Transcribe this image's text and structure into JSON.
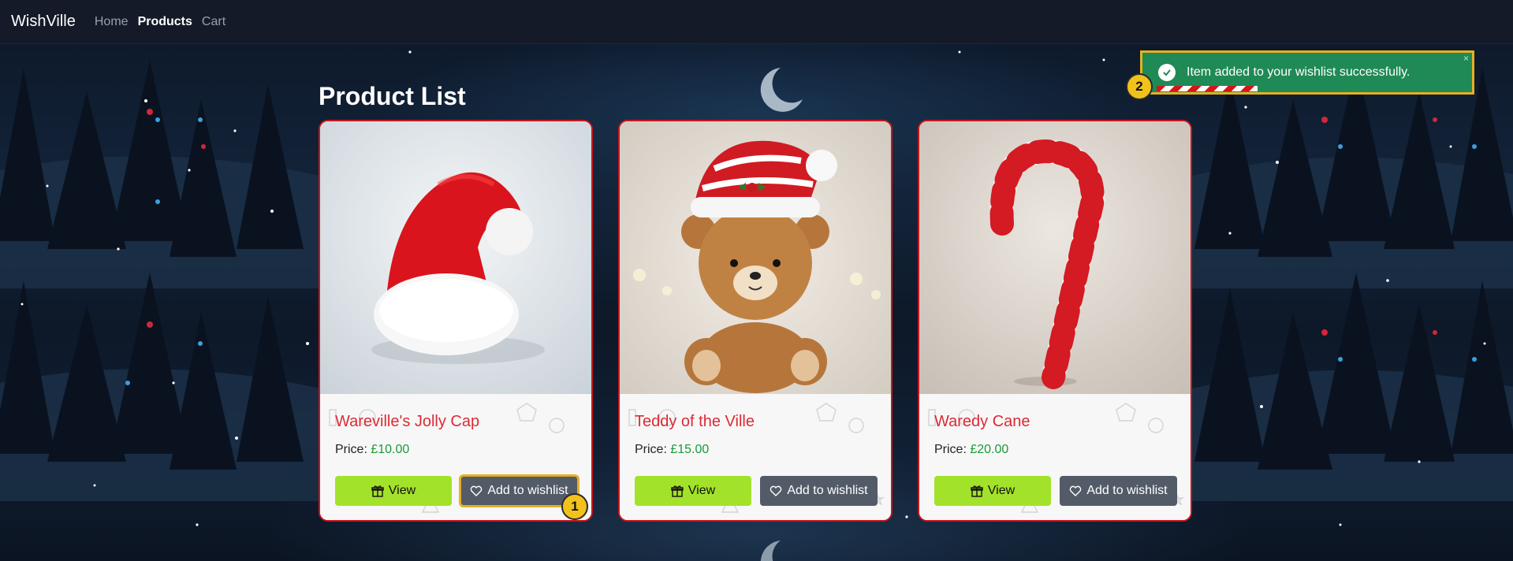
{
  "navbar": {
    "brand": "WishVille",
    "links": [
      {
        "label": "Home",
        "active": false
      },
      {
        "label": "Products",
        "active": true
      },
      {
        "label": "Cart",
        "active": false
      }
    ]
  },
  "page": {
    "title": "Product List"
  },
  "products": [
    {
      "name": "Wareville's Jolly Cap",
      "price_label": "Price:",
      "price": "£10.00",
      "image": "santa-hat",
      "view_label": "View",
      "wishlist_label": "Add to wishlist"
    },
    {
      "name": "Teddy of the Ville",
      "price_label": "Price:",
      "price": "£15.00",
      "image": "teddy-bear",
      "view_label": "View",
      "wishlist_label": "Add to wishlist"
    },
    {
      "name": "Waredy Cane",
      "price_label": "Price:",
      "price": "£20.00",
      "image": "candy-cane",
      "view_label": "View",
      "wishlist_label": "Add to wishlist"
    }
  ],
  "toast": {
    "message": "Item added to your wishlist successfully.",
    "icon": "check-circle-icon",
    "close": "×"
  },
  "annotations": {
    "marker_1": "1",
    "marker_2": "2"
  },
  "colors": {
    "accent_red": "#dc2a34",
    "price_green": "#1a9a3a",
    "view_button": "#a3e22b",
    "wishlist_button": "#535a68",
    "toast_bg": "#1f8a55",
    "highlight": "#e6b020"
  }
}
